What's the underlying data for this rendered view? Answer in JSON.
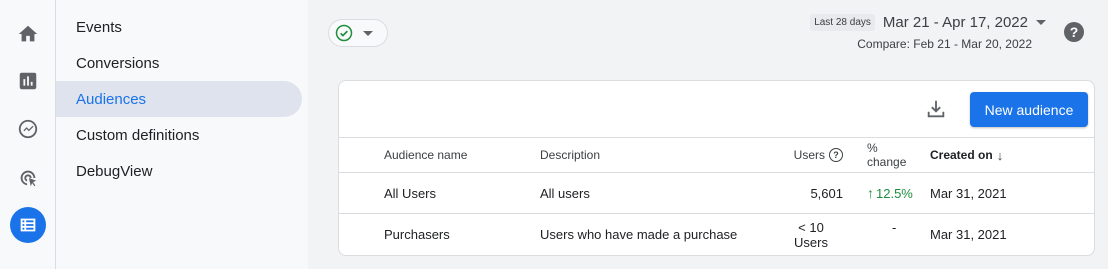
{
  "rail": {
    "items": [
      {
        "name": "home-icon"
      },
      {
        "name": "reports-icon"
      },
      {
        "name": "explore-icon"
      },
      {
        "name": "advertising-icon"
      },
      {
        "name": "configure-icon",
        "active": true
      }
    ]
  },
  "nav": {
    "items": [
      {
        "label": "Events"
      },
      {
        "label": "Conversions"
      },
      {
        "label": "Audiences",
        "active": true
      },
      {
        "label": "Custom definitions"
      },
      {
        "label": "DebugView"
      }
    ]
  },
  "header": {
    "date_chip": "Last 28 days",
    "date_range": "Mar 21 - Apr 17, 2022",
    "compare": "Compare: Feb 21 - Mar 20, 2022",
    "help": "?"
  },
  "toolbar": {
    "new_audience_label": "New audience"
  },
  "table": {
    "headers": {
      "name": "Audience name",
      "description": "Description",
      "users": "Users",
      "change": "% change",
      "created": "Created on"
    },
    "rows": [
      {
        "name": "All Users",
        "description": "All users",
        "users": "5,601",
        "change": "12.5%",
        "created": "Mar 31, 2021"
      },
      {
        "name": "Purchasers",
        "description": "Users who have made a purchase",
        "users_line1": "< 10",
        "users_line2": "Users",
        "change": "-",
        "created": "Mar 31, 2021"
      }
    ]
  },
  "colors": {
    "accent": "#1a73e8",
    "positive": "#1e8e3e",
    "active_nav_bg": "#dfe3ee"
  }
}
